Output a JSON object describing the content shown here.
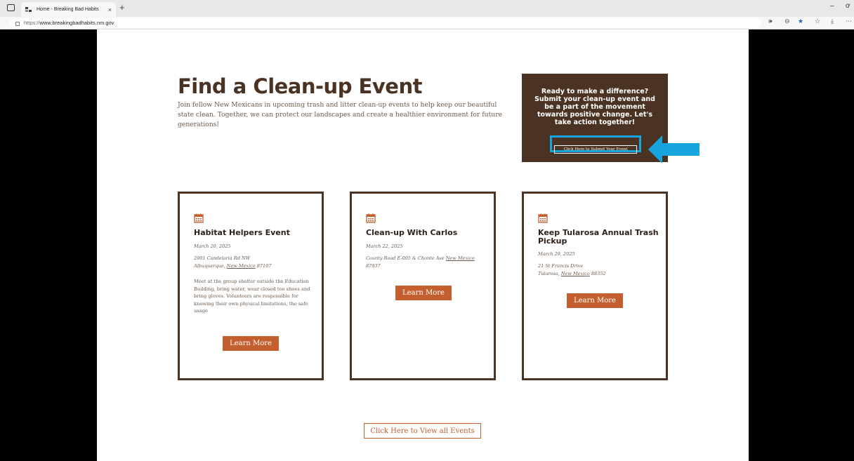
{
  "browser": {
    "tab_title": "Home - Breaking Bad Habits",
    "tab_close": "×",
    "new_tab": "+",
    "url_prefix": "https://",
    "url_host": "www.breakingbadhabits.nm.gov",
    "minimize": "–",
    "more": "⋯"
  },
  "hero": {
    "title": "Find a Clean-up Event",
    "intro": "Join fellow New Mexicans in upcoming trash and litter clean-up events to help keep our beautiful state clean. Together, we can protect our landscapes and create a healthier environment for future generations!"
  },
  "cta": {
    "text": "Ready to make a difference? Submit your clean-up event and be a part of the movement towards positive change. Let's take action together!",
    "button": "Click Here to Submit Your Event",
    "highlight_color": "#17a5e0"
  },
  "events": [
    {
      "title": "Habitat Helpers Event",
      "date": "March 20, 2025",
      "address_line1": "2901 Candelaria Rd NW",
      "address_city": "Albuquerque, ",
      "address_state": "New Mexico",
      "address_zip": " 87107",
      "description": "Meet at the group shelter outside the Education Building, bring water, wear closed toe shoes and bring gloves. Volunteers are responsible for knowing their own physical limitations, the safe usage",
      "button": "Learn More"
    },
    {
      "title": "Clean-up With Carlos",
      "date": "March 22, 2025",
      "address_line1": "County Road E-005 & Chonte Ave ",
      "address_state": "New Mexico",
      "address_zip": "87937",
      "button": "Learn More"
    },
    {
      "title": "Keep Tularosa Annual Trash Pickup",
      "date": "March 29, 2025",
      "address_line1": "21 St Francis Drive",
      "address_city": "Tularosa, ",
      "address_state": "New Mexico",
      "address_zip": " 88352",
      "button": "Learn More"
    }
  ],
  "view_all": "Click Here to View all Events",
  "colors": {
    "brand_brown": "#4a3322",
    "accent_orange": "#c35f2e"
  }
}
